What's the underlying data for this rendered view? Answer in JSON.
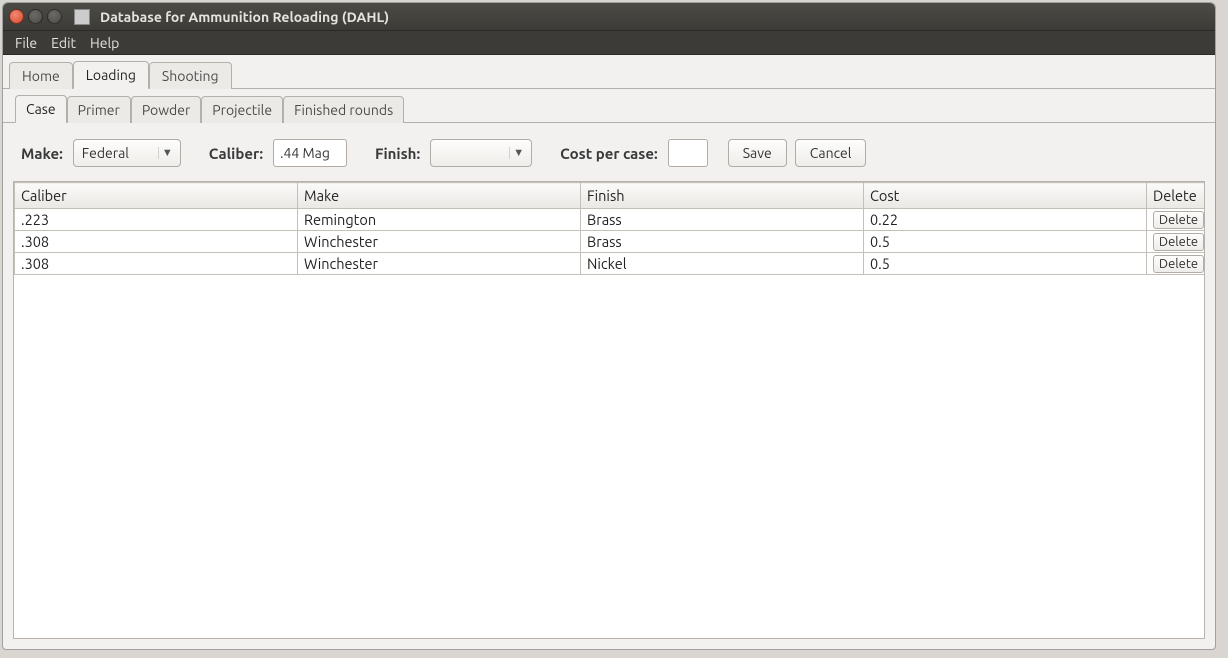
{
  "window": {
    "title": "Database for Ammunition Reloading (DAHL)"
  },
  "menubar": {
    "file": "File",
    "edit": "Edit",
    "help": "Help"
  },
  "main_tabs": [
    {
      "label": "Home",
      "active": false
    },
    {
      "label": "Loading",
      "active": true
    },
    {
      "label": "Shooting",
      "active": false
    }
  ],
  "sub_tabs": [
    {
      "label": "Case",
      "active": true
    },
    {
      "label": "Primer",
      "active": false
    },
    {
      "label": "Powder",
      "active": false
    },
    {
      "label": "Projectile",
      "active": false
    },
    {
      "label": "Finished rounds",
      "active": false
    }
  ],
  "form": {
    "make_label": "Make:",
    "make_value": "Federal",
    "caliber_label": "Caliber:",
    "caliber_value": ".44 Mag",
    "finish_label": "Finish:",
    "finish_value": "",
    "cost_label": "Cost per case:",
    "cost_value": "",
    "save_label": "Save",
    "cancel_label": "Cancel"
  },
  "table": {
    "headers": {
      "caliber": "Caliber",
      "make": "Make",
      "finish": "Finish",
      "cost": "Cost",
      "delete": "Delete"
    },
    "delete_btn": "Delete",
    "rows": [
      {
        "caliber": ".223",
        "make": "Remington",
        "finish": "Brass",
        "cost": "0.22"
      },
      {
        "caliber": ".308",
        "make": "Winchester",
        "finish": "Brass",
        "cost": "0.5"
      },
      {
        "caliber": ".308",
        "make": "Winchester",
        "finish": "Nickel",
        "cost": "0.5"
      }
    ]
  }
}
